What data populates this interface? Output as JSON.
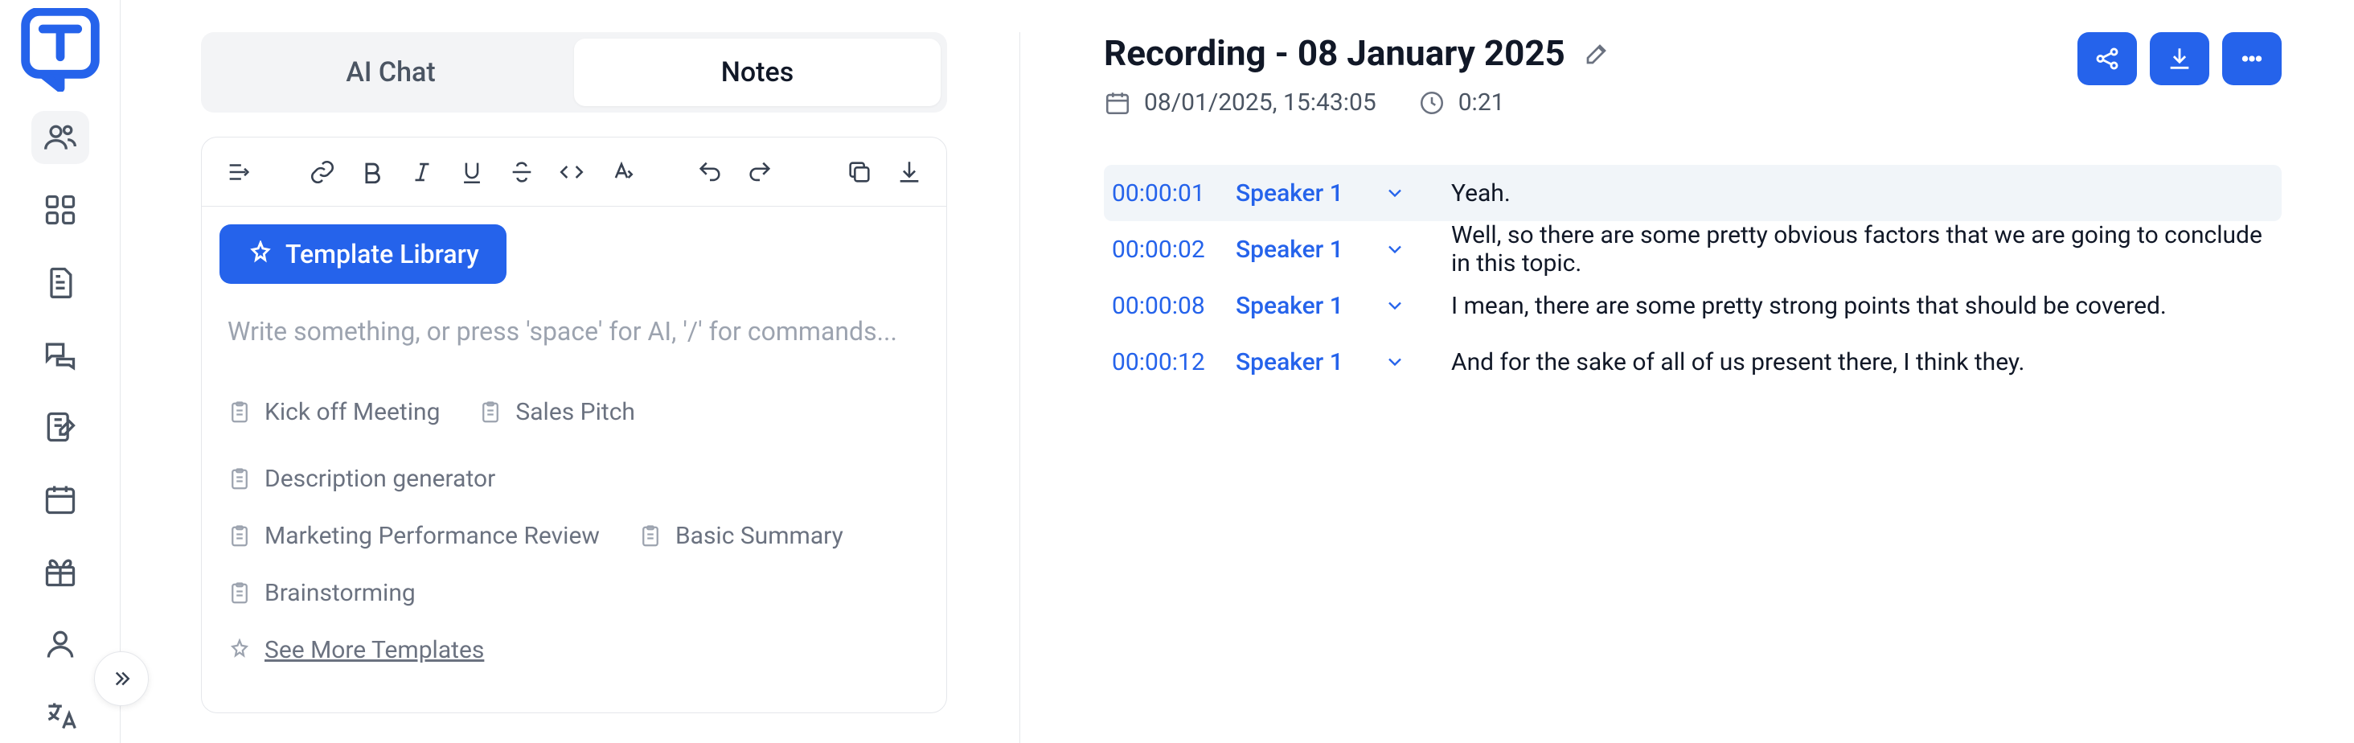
{
  "tabs": {
    "chat": "AI Chat",
    "notes": "Notes"
  },
  "template_library": "Template Library",
  "editor": {
    "placeholder": "Write something, or press 'space' for AI, '/' for commands..."
  },
  "templates": {
    "row1": [
      "Kick off Meeting",
      "Sales Pitch",
      "Description generator"
    ],
    "row2": [
      "Marketing Performance Review",
      "Basic Summary"
    ],
    "row3": [
      "Brainstorming"
    ],
    "see_more": "See More Templates"
  },
  "recording": {
    "title": "Recording - 08 January 2025",
    "date": "08/01/2025, 15:43:05",
    "duration": "0:21"
  },
  "transcript": [
    {
      "time": "00:00:01",
      "speaker": "Speaker 1",
      "text": "Yeah.",
      "highlight": true
    },
    {
      "time": "00:00:02",
      "speaker": "Speaker 1",
      "text": "Well, so there are some pretty obvious factors that we are going to conclude in this topic."
    },
    {
      "time": "00:00:08",
      "speaker": "Speaker 1",
      "text": "I mean, there are some pretty strong points that should be covered."
    },
    {
      "time": "00:00:12",
      "speaker": "Speaker 1",
      "text": "And for the sake of all of us present there, I think they."
    }
  ]
}
